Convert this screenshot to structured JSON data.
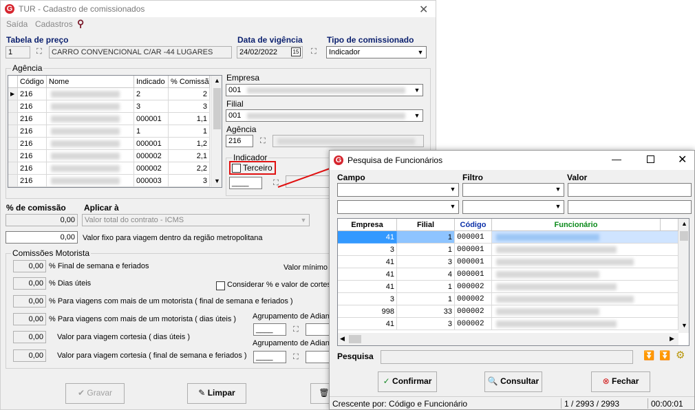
{
  "main": {
    "title": "TUR - Cadastro de comissionados",
    "menu": [
      "Saída",
      "Cadastros"
    ],
    "tabela_label": "Tabela de preço",
    "tabela_code": "1",
    "tabela_desc": "CARRO CONVENCIONAL C/AR -44 LUGARES",
    "data_label": "Data de vigência",
    "data_value": "24/02/2022",
    "tipo_label": "Tipo de comissionado",
    "tipo_value": "Indicador",
    "agencia_group": "Agência",
    "grid_headers": [
      "Código",
      "Nome",
      "Indicado",
      "% Comissão"
    ],
    "grid_rows": [
      {
        "codigo": "216",
        "indicado": "2",
        "comissao": "2"
      },
      {
        "codigo": "216",
        "indicado": "3",
        "comissao": "3"
      },
      {
        "codigo": "216",
        "indicado": "000001",
        "comissao": "1,1"
      },
      {
        "codigo": "216",
        "indicado": "1",
        "comissao": "1"
      },
      {
        "codigo": "216",
        "indicado": "000001",
        "comissao": "1,2"
      },
      {
        "codigo": "216",
        "indicado": "000002",
        "comissao": "2,1"
      },
      {
        "codigo": "216",
        "indicado": "000002",
        "comissao": "2,2"
      },
      {
        "codigo": "216",
        "indicado": "000003",
        "comissao": "3"
      }
    ],
    "empresa_label": "Empresa",
    "empresa_value": "001",
    "filial_label": "Filial",
    "filial_value": "001",
    "agencia_label": "Agência",
    "agencia_value": "216",
    "indicador_label": "Indicador",
    "terceiro_label": "Terceiro",
    "comissao_label": "% de comissão",
    "comissao_value": "0,00",
    "aplicar_label": "Aplicar à",
    "aplicar_value": "Valor total do contrato - ICMS",
    "valor_fixo_value": "0,00",
    "valor_fixo_label": "Valor fixo para viagem dentro da região metropolitana",
    "comissoes_group": "Comissões Motorista",
    "motorista_rows": [
      {
        "value": "0,00",
        "label": "% Final de semana e feriados"
      },
      {
        "value": "0,00",
        "label": "% Dias úteis"
      },
      {
        "value": "0,00",
        "label": "% Para viagens com mais de um motorista ( final de semana e feriados )"
      },
      {
        "value": "0,00",
        "label": "% Para viagens com mais de um motorista ( dias úteis )"
      },
      {
        "value": "0,00",
        "label": "Valor para viagem cortesia ( dias úteis )"
      },
      {
        "value": "0,00",
        "label": "Valor para viagem cortesia ( final de semana e feriados )"
      }
    ],
    "valor_minimo_label": "Valor mínimo d",
    "considerar_label": "Considerar % e valor de cortesia",
    "agrupamento_label_1": "Agrupamento de Adianta",
    "agrupamento_label_2": "Agrupamento de Adianta",
    "gravar_label": "Gravar",
    "limpar_label": "Limpar"
  },
  "dialog": {
    "title": "Pesquisa de Funcionários",
    "campo_label": "Campo",
    "filtro_label": "Filtro",
    "valor_label": "Valor",
    "headers": [
      "Empresa",
      "Filial",
      "Código",
      "Funcionário"
    ],
    "rows": [
      {
        "empresa": "41",
        "filial": "1",
        "codigo": "000001"
      },
      {
        "empresa": "3",
        "filial": "1",
        "codigo": "000001"
      },
      {
        "empresa": "41",
        "filial": "3",
        "codigo": "000001"
      },
      {
        "empresa": "41",
        "filial": "4",
        "codigo": "000001"
      },
      {
        "empresa": "41",
        "filial": "1",
        "codigo": "000002"
      },
      {
        "empresa": "3",
        "filial": "1",
        "codigo": "000002"
      },
      {
        "empresa": "998",
        "filial": "33",
        "codigo": "000002"
      },
      {
        "empresa": "41",
        "filial": "3",
        "codigo": "000002"
      }
    ],
    "pesquisa_label": "Pesquisa",
    "confirmar_label": "Confirmar",
    "consultar_label": "Consultar",
    "fechar_label": "Fechar",
    "status_order": "Crescente por: Código e Funcionário",
    "status_count": "1 / 2993 / 2993",
    "status_time": "00:00:01"
  },
  "colors": {
    "accent_red": "#d6262f",
    "selection_blue": "#3399ff",
    "code_header_blue": "#0a2fa8",
    "func_header_green": "#0a8a1a"
  }
}
